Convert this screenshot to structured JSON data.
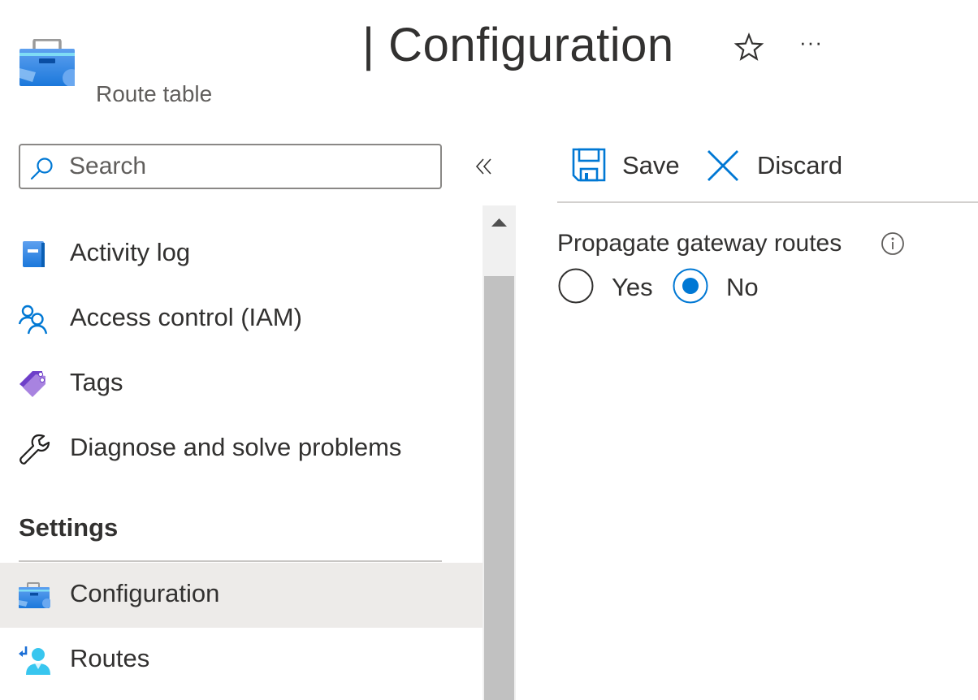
{
  "header": {
    "resource_icon": "briefcase-icon",
    "title": "| Configuration",
    "resource_type": "Route table",
    "favorite_icon": "star-icon",
    "more_label": "···"
  },
  "sidebar": {
    "search": {
      "placeholder": "Search",
      "value": "",
      "icon": "search-icon"
    },
    "collapse_icon": "double-chevron-left-icon",
    "items": [
      {
        "label": "Activity log",
        "icon": "activity-log-icon",
        "selected": false
      },
      {
        "label": "Access control (IAM)",
        "icon": "people-icon",
        "selected": false
      },
      {
        "label": "Tags",
        "icon": "tag-icon",
        "selected": false
      },
      {
        "label": "Diagnose and solve problems",
        "icon": "wrench-icon",
        "selected": false
      }
    ],
    "sections": [
      {
        "header": "Settings",
        "items": [
          {
            "label": "Configuration",
            "icon": "briefcase-icon",
            "selected": true
          },
          {
            "label": "Routes",
            "icon": "routes-icon",
            "selected": false
          }
        ]
      }
    ]
  },
  "toolbar": {
    "save_label": "Save",
    "save_icon": "save-icon",
    "discard_label": "Discard",
    "discard_icon": "close-icon"
  },
  "form": {
    "field_label": "Propagate gateway routes",
    "info_icon": "info-icon",
    "options": [
      {
        "label": "Yes",
        "selected": false
      },
      {
        "label": "No",
        "selected": true
      }
    ],
    "selected_value": "No"
  },
  "colors": {
    "accent": "#0078d4",
    "selected_bg": "#edebe9",
    "text": "#323130",
    "subtle_text": "#605e5c"
  }
}
